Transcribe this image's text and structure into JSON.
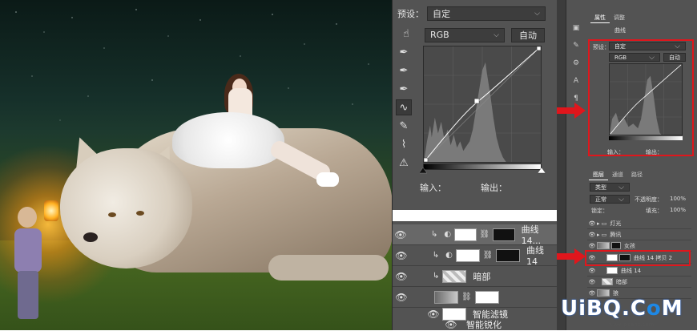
{
  "curves_panel": {
    "preset_label": "预设：",
    "preset_value": "自定",
    "channel": "RGB",
    "auto_button": "自动",
    "input_label": "输入：",
    "output_label": "输出："
  },
  "layers": [
    {
      "name": "曲线 14...",
      "selected": true
    },
    {
      "name": "曲线 14",
      "selected": false
    },
    {
      "name": "暗部",
      "selected": false
    },
    {
      "name": "",
      "selected": false
    },
    {
      "name": "智能滤镜",
      "selected": false
    },
    {
      "name": "智能锐化",
      "selected": false
    }
  ],
  "right_panel": {
    "tab_properties": "属性",
    "tab_adjust": "调整",
    "curves_label": "曲线",
    "preset_label": "预设：",
    "preset_value": "自定",
    "channel": "RGB",
    "auto_button": "自动",
    "input_label": "输入：",
    "output_label": "输出：",
    "layers_tab": "图层",
    "channels_tab": "通道",
    "paths_tab": "路径",
    "kind_label": "类型",
    "blend_mode": "正常",
    "opacity_label": "不透明度：",
    "opacity_value": "100%",
    "lock_label": "锁定：",
    "fill_label": "填充：",
    "fill_value": "100%",
    "layers": [
      {
        "name": "灯光"
      },
      {
        "name": "腾讯"
      },
      {
        "name": "女孩"
      },
      {
        "name": "曲线 14 拷贝 2"
      },
      {
        "name": "曲线 14"
      },
      {
        "name": "暗部"
      },
      {
        "name": "狼"
      }
    ]
  },
  "watermark": {
    "logo_a": "UiBQ.C",
    "logo_b": "o",
    "logo_c": "M",
    "url": "www.psahz.com"
  },
  "colors": {
    "accent_red": "#e0161c",
    "panel_bg": "#535353",
    "logo_blue": "#1e88e5"
  }
}
